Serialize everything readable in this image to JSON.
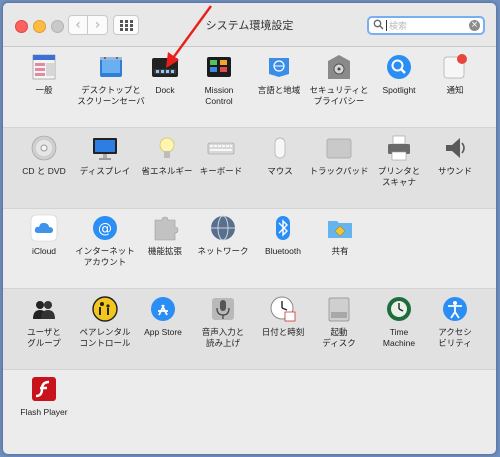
{
  "window": {
    "title": "システム環境設定"
  },
  "search": {
    "placeholder": "検索"
  },
  "rows": [
    [
      {
        "label": "一般",
        "icon": "general-icon"
      },
      {
        "label": "デスクトップと\nスクリーンセーバ",
        "icon": "desktop-screensaver-icon"
      },
      {
        "label": "Dock",
        "icon": "dock-icon"
      },
      {
        "label": "Mission\nControl",
        "icon": "mission-control-icon"
      },
      {
        "label": "言語と地域",
        "icon": "language-region-icon"
      },
      {
        "label": "セキュリティと\nプライバシー",
        "icon": "security-privacy-icon"
      },
      {
        "label": "Spotlight",
        "icon": "spotlight-icon"
      },
      {
        "label": "通知",
        "icon": "notifications-icon"
      }
    ],
    [
      {
        "label": "CD と DVD",
        "icon": "cd-dvd-icon"
      },
      {
        "label": "ディスプレイ",
        "icon": "display-icon"
      },
      {
        "label": "省エネルギー",
        "icon": "energy-saver-icon"
      },
      {
        "label": "キーボード",
        "icon": "keyboard-icon"
      },
      {
        "label": "マウス",
        "icon": "mouse-icon"
      },
      {
        "label": "トラックパッド",
        "icon": "trackpad-icon"
      },
      {
        "label": "プリンタと\nスキャナ",
        "icon": "printer-scanner-icon"
      },
      {
        "label": "サウンド",
        "icon": "sound-icon"
      }
    ],
    [
      {
        "label": "iCloud",
        "icon": "icloud-icon"
      },
      {
        "label": "インターネット\nアカウント",
        "icon": "internet-accounts-icon"
      },
      {
        "label": "機能拡張",
        "icon": "extensions-icon"
      },
      {
        "label": "ネットワーク",
        "icon": "network-icon"
      },
      {
        "label": "Bluetooth",
        "icon": "bluetooth-icon"
      },
      {
        "label": "共有",
        "icon": "sharing-icon"
      }
    ],
    [
      {
        "label": "ユーザと\nグループ",
        "icon": "users-groups-icon"
      },
      {
        "label": "ペアレンタル\nコントロール",
        "icon": "parental-controls-icon"
      },
      {
        "label": "App Store",
        "icon": "app-store-icon"
      },
      {
        "label": "音声入力と\n読み上げ",
        "icon": "dictation-speech-icon"
      },
      {
        "label": "日付と時刻",
        "icon": "date-time-icon"
      },
      {
        "label": "起動\nディスク",
        "icon": "startup-disk-icon"
      },
      {
        "label": "Time\nMachine",
        "icon": "time-machine-icon"
      },
      {
        "label": "アクセシ\nビリティ",
        "icon": "accessibility-icon"
      }
    ],
    [
      {
        "label": "Flash Player",
        "icon": "flash-player-icon"
      }
    ]
  ],
  "colors": {
    "search_focus": "#7aaef2",
    "close": "#fc615d",
    "minimize": "#fdbc40",
    "annotation_arrow": "#e8201c"
  }
}
